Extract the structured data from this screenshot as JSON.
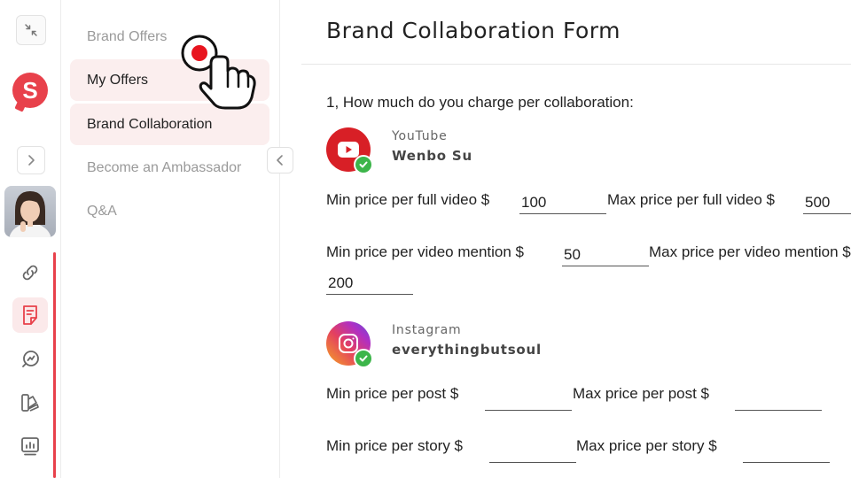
{
  "sidebar": {
    "items": [
      {
        "label": "Brand Offers"
      },
      {
        "label": "My Offers"
      },
      {
        "label": "Brand Collaboration"
      },
      {
        "label": "Become an Ambassador"
      },
      {
        "label": "Q&A"
      }
    ]
  },
  "brand_logo_letter": "S",
  "main": {
    "title": "Brand Collaboration Form",
    "question": "1, How much do you charge per collaboration:",
    "youtube": {
      "platform": "YouTube",
      "handle": "Wenbo Su",
      "min_full_label": "Min price per full video $",
      "min_full_value": "100",
      "max_full_label": "Max price per full video $",
      "max_full_value": "500",
      "min_mention_label": "Min price per video mention $",
      "min_mention_value": "50",
      "max_mention_label": "Max price per video mention $",
      "max_mention_value": "200"
    },
    "instagram": {
      "platform": "Instagram",
      "handle": "everythingbutsoul",
      "min_post_label": "Min price per post $",
      "min_post_value": "",
      "max_post_label": "Max price per post $",
      "max_post_value": "",
      "min_story_label": "Min price per story $",
      "min_story_value": "",
      "max_story_label": "Max price per story $",
      "max_story_value": ""
    }
  },
  "colors": {
    "accent": "#e8414b",
    "highlight": "#fbeeee",
    "youtube": "#d81f26",
    "verified": "#3cb54a"
  }
}
